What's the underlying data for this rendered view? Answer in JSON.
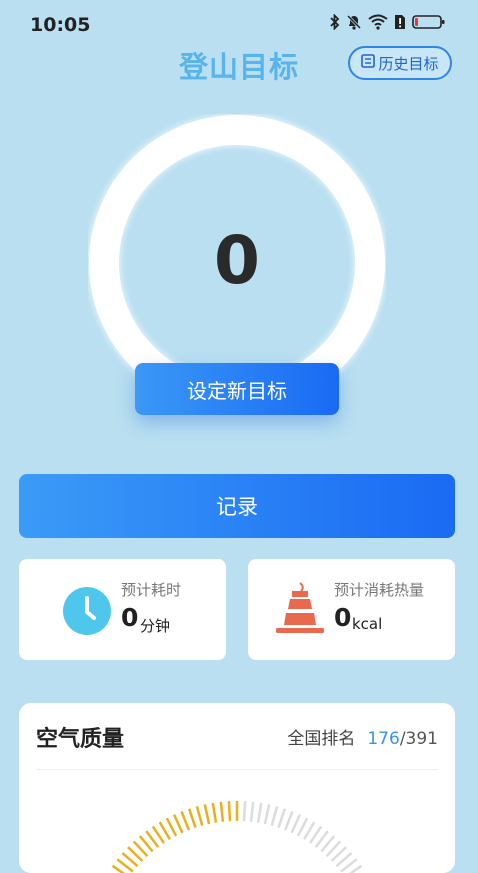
{
  "status_bar": {
    "time": "10:05"
  },
  "header": {
    "title": "登山目标",
    "history_label": "历史目标"
  },
  "goal": {
    "value": "0",
    "set_label": "设定新目标"
  },
  "record": {
    "label": "记录"
  },
  "stats": {
    "time": {
      "label": "预计耗时",
      "value": "0",
      "unit": "分钟"
    },
    "calories": {
      "label": "预计消耗热量",
      "value": "0",
      "unit": "kcal"
    }
  },
  "air_quality": {
    "title": "空气质量",
    "rank_label": "全国排名",
    "rank_current": "176",
    "rank_total": "391"
  },
  "colors": {
    "background": "#b9dff0",
    "title_blue": "#58b4ea",
    "button_blue": "#1a6af3",
    "clock_icon": "#4fc7ec",
    "cone_icon": "#e9694f",
    "gauge_active": "#e8b020",
    "gauge_inactive": "#dcdcdc"
  }
}
